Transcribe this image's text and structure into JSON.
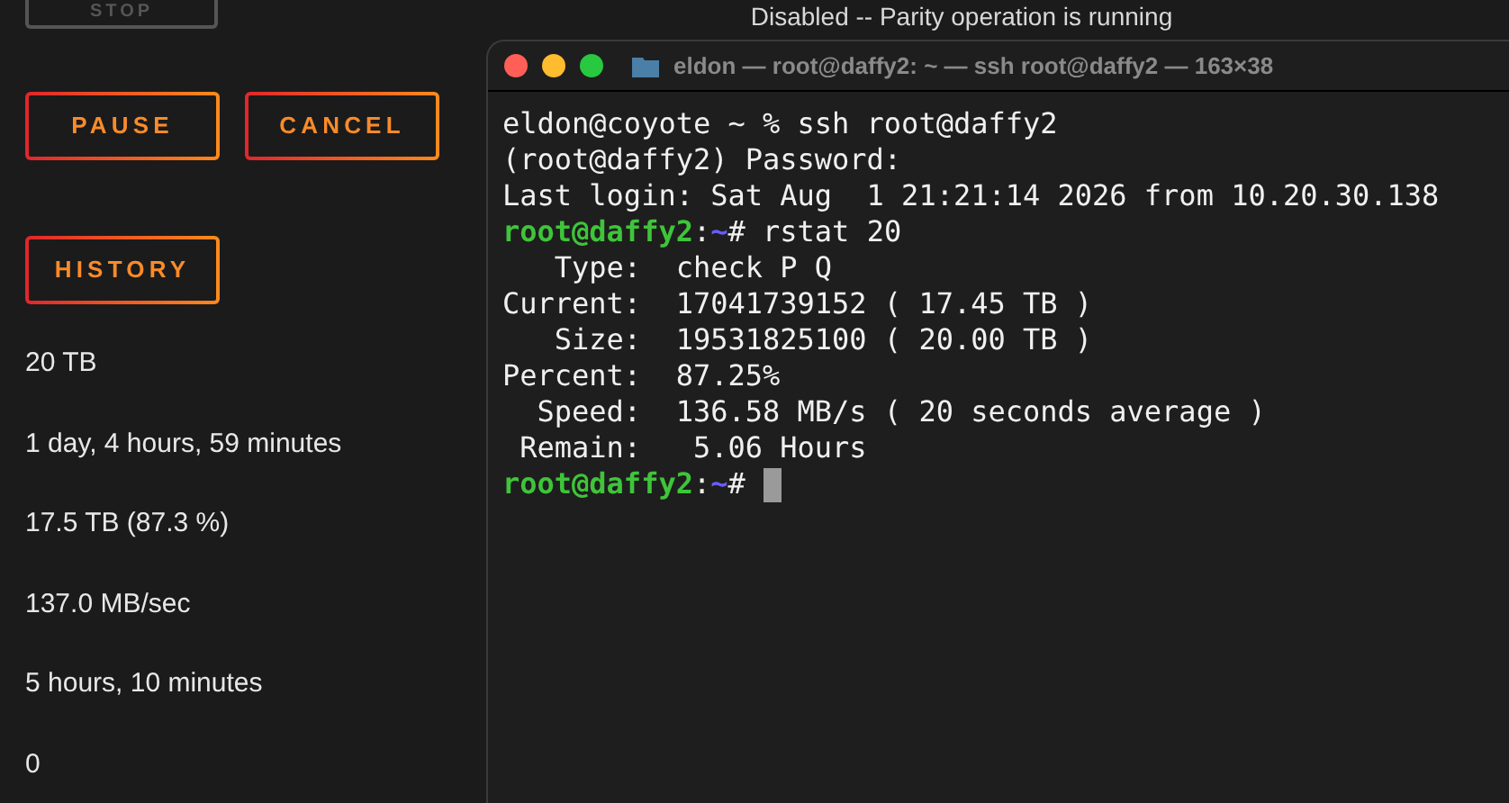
{
  "left_panel": {
    "stop_button": {
      "label": "STOP",
      "disabled": true
    },
    "buttons": [
      {
        "label": "PAUSE"
      },
      {
        "label": "CANCEL"
      }
    ],
    "history_button": {
      "label": "HISTORY"
    },
    "values": [
      "20 TB",
      "1 day, 4 hours, 59 minutes",
      "17.5 TB (87.3 %)",
      "137.0 MB/sec",
      "5 hours, 10 minutes",
      "0"
    ]
  },
  "status_message": "Disabled -- Parity operation is running",
  "terminal": {
    "title": "eldon — root@daffy2: ~ — ssh root@daffy2 — 163×38",
    "lines": [
      {
        "kind": "text",
        "text": "eldon@coyote ~ % ssh root@daffy2"
      },
      {
        "kind": "text",
        "text": "(root@daffy2) Password:"
      },
      {
        "kind": "text",
        "text": "Last login: Sat Aug  1 21:21:14 2026 from 10.20.30.138"
      },
      {
        "kind": "prompt",
        "host": "root@daffy2",
        "sep": ":",
        "path": "~",
        "symbol": "#",
        "command": "rstat 20"
      },
      {
        "kind": "text",
        "text": "   Type:  check P Q"
      },
      {
        "kind": "text",
        "text": "Current:  17041739152 ( 17.45 TB )"
      },
      {
        "kind": "text",
        "text": "   Size:  19531825100 ( 20.00 TB )"
      },
      {
        "kind": "text",
        "text": "Percent:  87.25%"
      },
      {
        "kind": "text",
        "text": "  Speed:  136.58 MB/s ( 20 seconds average )"
      },
      {
        "kind": "text",
        "text": " Remain:   5.06 Hours"
      },
      {
        "kind": "prompt",
        "host": "root@daffy2",
        "sep": ":",
        "path": "~",
        "symbol": "#",
        "cursor": true
      }
    ]
  }
}
